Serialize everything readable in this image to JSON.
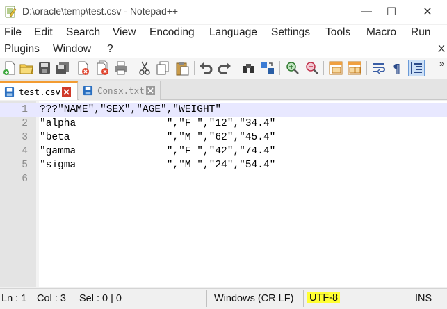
{
  "window": {
    "title": "D:\\oracle\\temp\\test.csv - Notepad++",
    "minimize": "—",
    "maximize": "☐",
    "close": "✕"
  },
  "menu": {
    "row1": [
      "File",
      "Edit",
      "Search",
      "View",
      "Encoding",
      "Language",
      "Settings",
      "Tools",
      "Macro",
      "Run"
    ],
    "row2": [
      "Plugins",
      "Window",
      "?"
    ],
    "close_doc": "X"
  },
  "toolbar": {
    "icons": [
      "new-file-icon",
      "open-file-icon",
      "save-icon",
      "save-all-icon",
      "close-icon",
      "close-all-icon",
      "print-icon",
      "cut-icon",
      "copy-icon",
      "paste-icon",
      "undo-icon",
      "redo-icon",
      "find-icon",
      "replace-icon",
      "zoom-in-icon",
      "zoom-out-icon",
      "sync-vertical-icon",
      "sync-horizontal-icon",
      "word-wrap-icon",
      "show-all-chars-icon",
      "indent-guide-icon"
    ],
    "more": "»"
  },
  "tabs": [
    {
      "label": "test.csv",
      "active": true
    },
    {
      "label": "Consx.txt",
      "active": false
    }
  ],
  "editor": {
    "lines": [
      {
        "n": "1",
        "text": "???\"NAME\",\"SEX\",\"AGE\",\"WEIGHT\""
      },
      {
        "n": "2",
        "text": "\"alpha               \",\"F \",\"12\",\"34.4\""
      },
      {
        "n": "3",
        "text": "\"beta                \",\"M \",\"62\",\"45.4\""
      },
      {
        "n": "4",
        "text": "\"gamma               \",\"F \",\"42\",\"74.4\""
      },
      {
        "n": "5",
        "text": "\"sigma               \",\"M \",\"24\",\"54.4\""
      },
      {
        "n": "6",
        "text": ""
      }
    ]
  },
  "status": {
    "ln": "Ln : 1",
    "col": "Col : 3",
    "sel": "Sel : 0 | 0",
    "eol": "Windows (CR LF)",
    "encoding": "UTF-8",
    "mode": "INS"
  },
  "colors": {
    "encoding_highlight": "#ffff33",
    "active_tab_accent": "#f39c32",
    "current_line": "#e8e8ff"
  }
}
